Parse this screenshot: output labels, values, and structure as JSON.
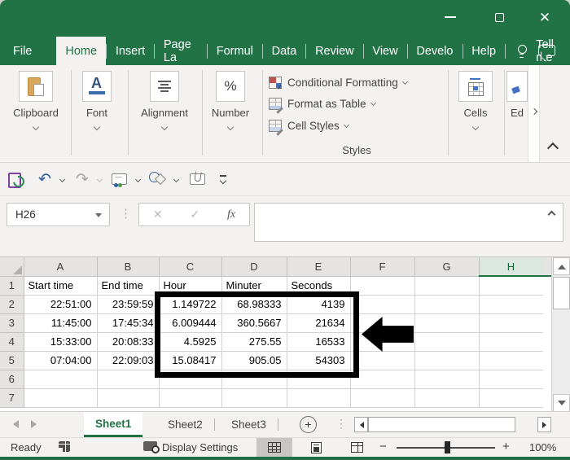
{
  "menu": {
    "tabs": [
      "File",
      "Home",
      "Insert",
      "Page La",
      "Formul",
      "Data",
      "Review",
      "View",
      "Develo",
      "Help"
    ],
    "active_tab": "Home",
    "tell_me": "Tell me"
  },
  "ribbon": {
    "groups": [
      {
        "label": "Clipboard"
      },
      {
        "label": "Font"
      },
      {
        "label": "Alignment"
      },
      {
        "label": "Number"
      }
    ],
    "styles": {
      "label": "Styles",
      "items": [
        "Conditional Formatting",
        "Format as Table",
        "Cell Styles"
      ]
    },
    "cells_label": "Cells",
    "editing_label": "Ed",
    "font_glyph": "A",
    "percent_glyph": "%"
  },
  "formula_bar": {
    "name_box": "H26",
    "cancel_glyph": "✕",
    "enter_glyph": "✓",
    "fx_label": "fx"
  },
  "spreadsheet": {
    "column_headers": [
      "A",
      "B",
      "C",
      "D",
      "E",
      "F",
      "G",
      "H"
    ],
    "selected_column": "H",
    "selected_cell": "H26",
    "row_headers": [
      "1",
      "2",
      "3",
      "4",
      "5",
      "6",
      "7"
    ],
    "rows": [
      [
        "Start time",
        "End time",
        "Hour",
        "Minuter",
        "Seconds"
      ],
      [
        "22:51:00",
        "23:59:59",
        "1.149722",
        "68.98333",
        "4139"
      ],
      [
        "11:45:00",
        "17:45:34",
        "6.009444",
        "360.5667",
        "21634"
      ],
      [
        "15:33:00",
        "20:08:33",
        "4.5925",
        "275.55",
        "16533"
      ],
      [
        "07:04:00",
        "22:09:03",
        "15.08417",
        "905.05",
        "54303"
      ]
    ]
  },
  "sheet_bar": {
    "tabs": [
      "Sheet1",
      "Sheet2",
      "Sheet3"
    ],
    "active_tab": "Sheet1",
    "new_sheet_glyph": "+"
  },
  "status_bar": {
    "mode": "Ready",
    "display_settings": "Display Settings",
    "zoom_out_glyph": "−",
    "zoom_in_glyph": "+",
    "zoom_level": "100%"
  },
  "colors": {
    "excel_green": "#217346",
    "annotation": "#000000"
  }
}
